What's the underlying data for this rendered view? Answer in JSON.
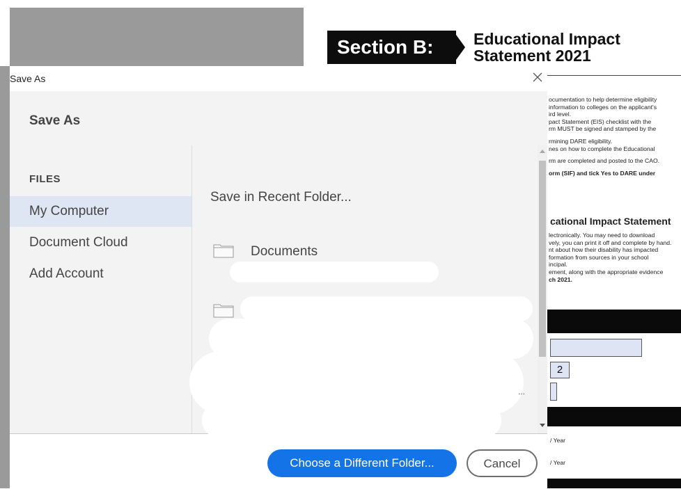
{
  "background_document": {
    "section_label": "Section B:",
    "title": "Educational Impact\nStatement 2021",
    "lines_top": [
      "ocumentation to help determine eligibility",
      " information to colleges on the applicant's",
      "ird level.",
      "pact Statement (EIS) checklist with the",
      "rm MUST be signed and stamped by the",
      "",
      "rmining DARE eligibility.",
      "nes on how to complete the Educational",
      "",
      "rm are completed and posted to the CAO.",
      "",
      "orm (SIF) and tick Yes to DARE under"
    ],
    "heading": "cational Impact Statement",
    "lines_bottom": [
      "lectronically. You may need to download",
      "vely, you can print it off and complete by hand.",
      "nt about how their disability has impacted",
      "",
      "formation from sources in your school",
      "",
      "incipal.",
      "ement, along with the appropriate evidence",
      "ch 2021."
    ],
    "digit": "2",
    "year_label_1": "/ Year",
    "year_label_2": "/ Year"
  },
  "dialog": {
    "window_title": "Save As",
    "close_icon": "close-icon",
    "header_title": "Save As",
    "sidebar": {
      "section_label": "FILES",
      "items": [
        {
          "label": "My Computer",
          "selected": true
        },
        {
          "label": "Document Cloud",
          "selected": false
        },
        {
          "label": "Add Account",
          "selected": false
        }
      ]
    },
    "content": {
      "recent_label": "Save in Recent Folder...",
      "folders": [
        {
          "name": "Documents",
          "icon": "folder-icon"
        },
        {
          "name": "",
          "icon": "folder-icon"
        }
      ],
      "ellipsis": "..."
    },
    "footer": {
      "primary_button": "Choose a Different Folder...",
      "cancel_button": "Cancel"
    },
    "colors": {
      "primary": "#1473e6",
      "selected_item": "#dde6f2",
      "panel_bg": "#f3f3f3"
    }
  }
}
